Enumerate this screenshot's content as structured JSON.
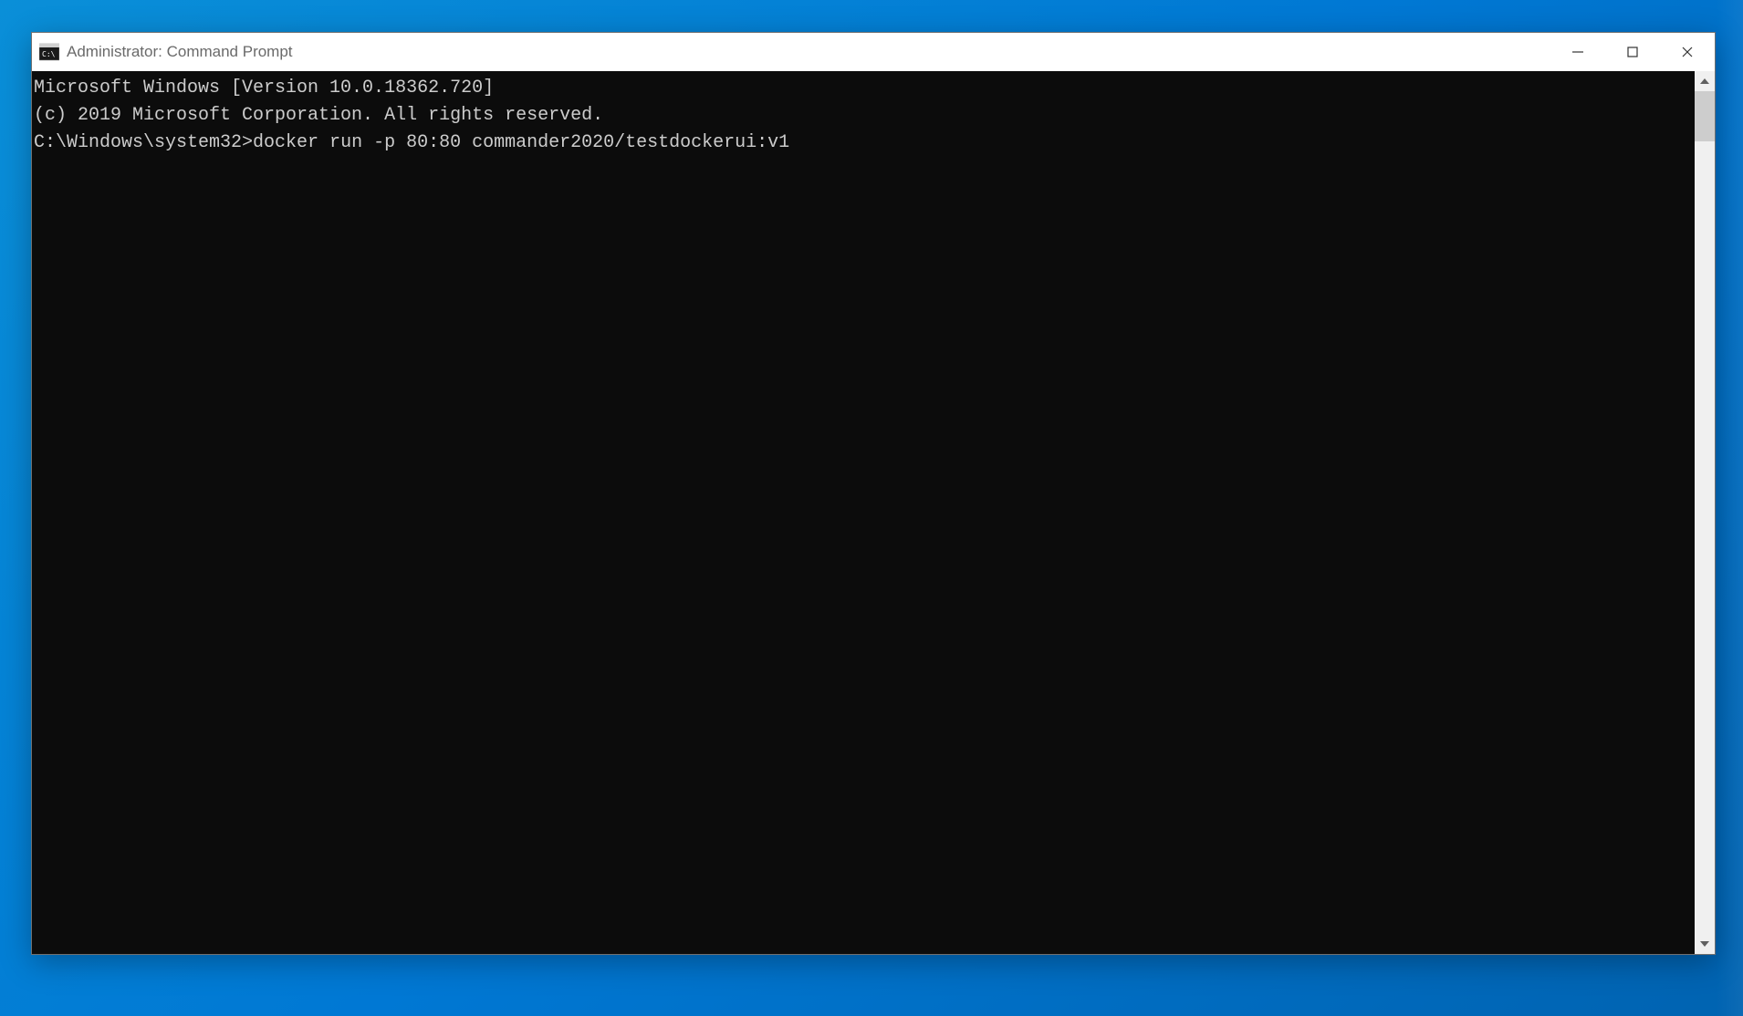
{
  "window": {
    "title": "Administrator: Command Prompt"
  },
  "console": {
    "lines": {
      "l0": "Microsoft Windows [Version 10.0.18362.720]",
      "l1": "(c) 2019 Microsoft Corporation. All rights reserved.",
      "l2": "",
      "l3_prompt": "C:\\Windows\\system32>",
      "l3_command": "docker run -p 80:80 commander2020/testdockerui:v1"
    }
  }
}
